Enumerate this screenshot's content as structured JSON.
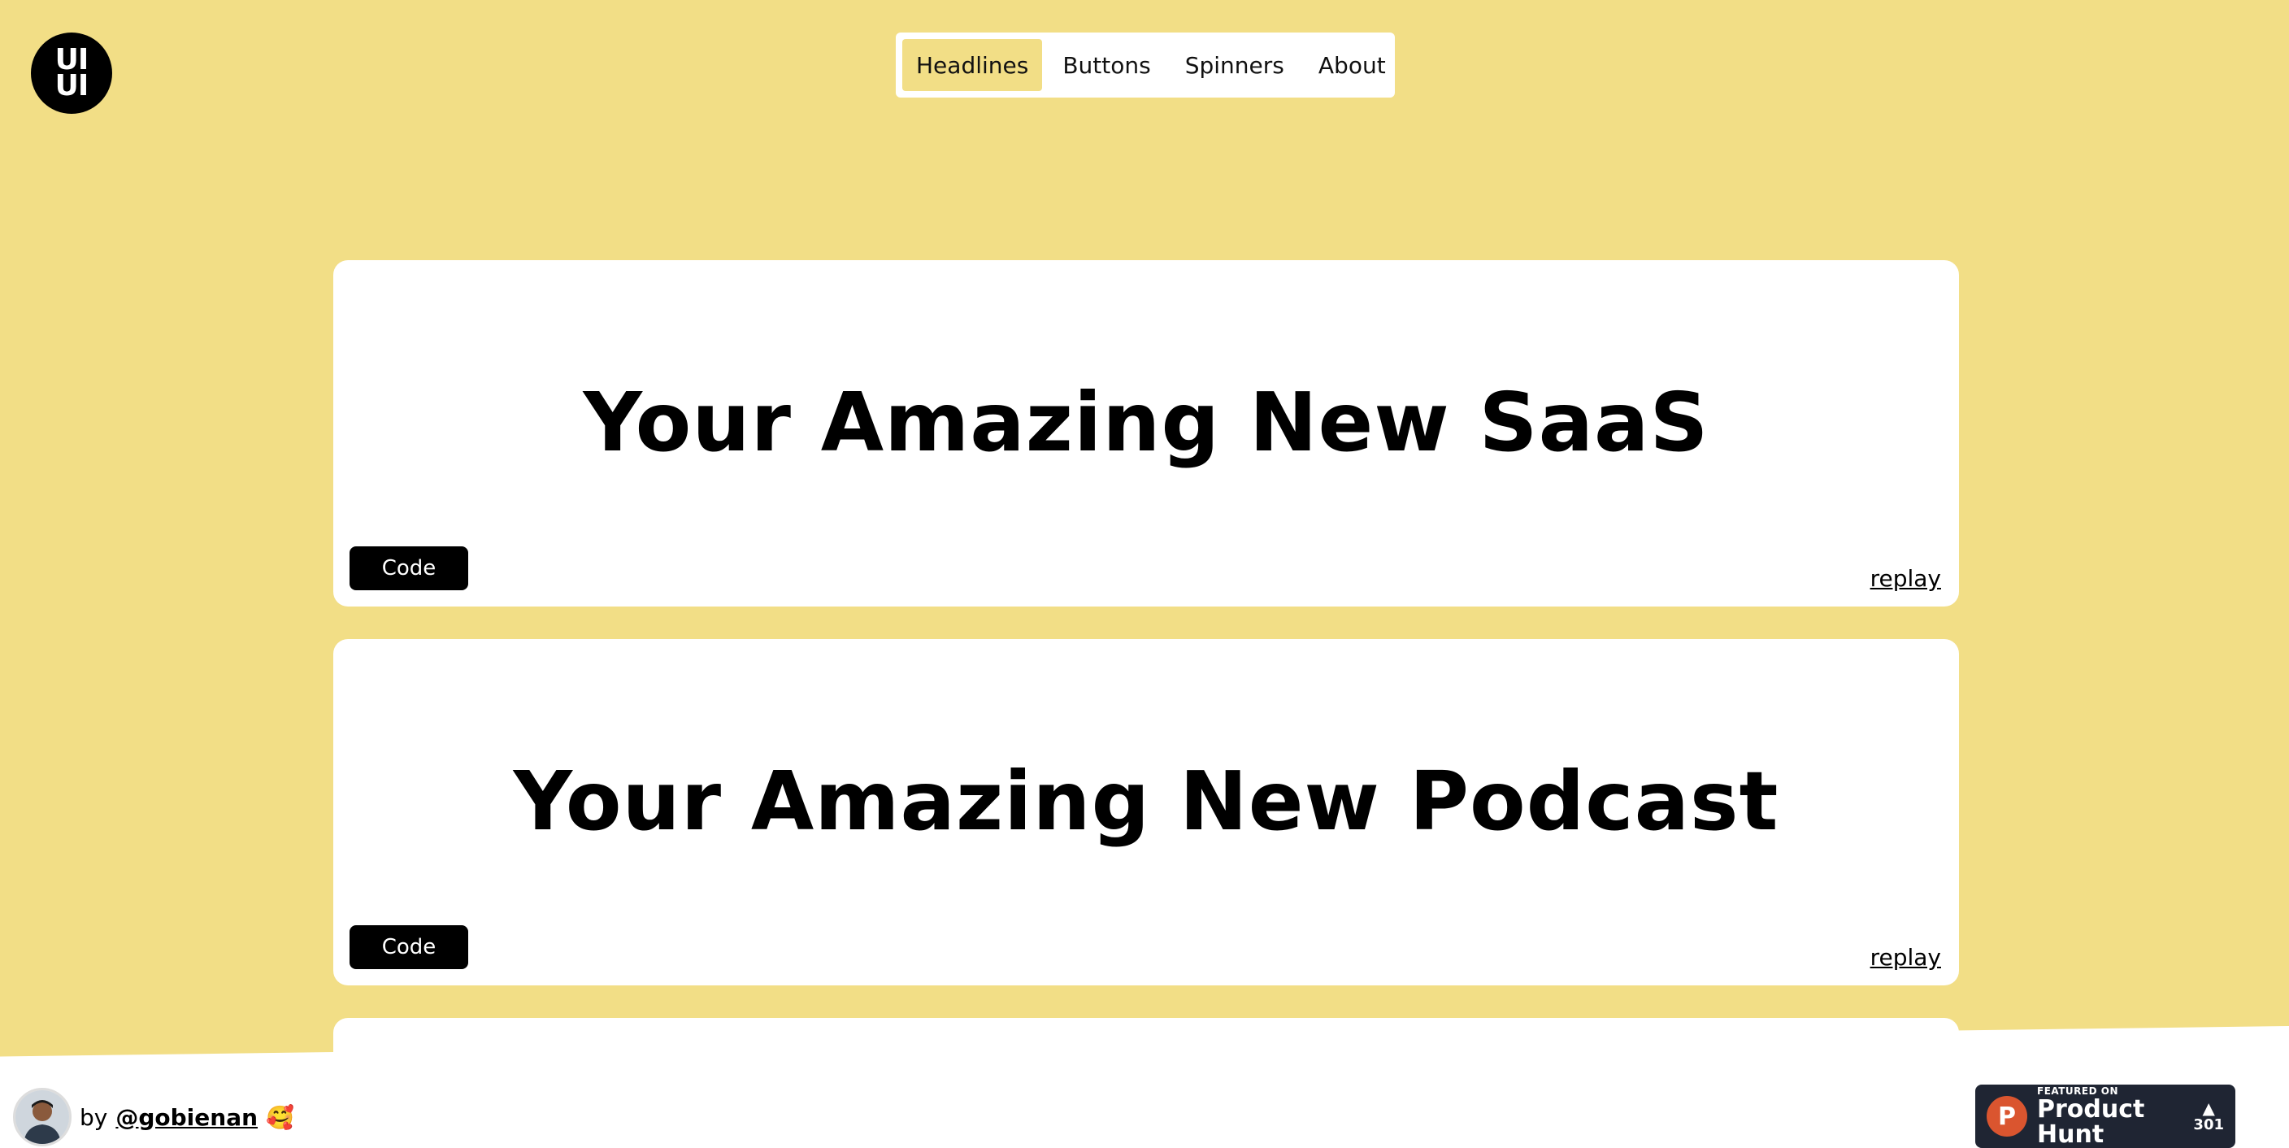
{
  "logo": {
    "line1": "UI",
    "line2": "UI"
  },
  "nav": {
    "items": [
      {
        "label": "Headlines",
        "active": true
      },
      {
        "label": "Buttons",
        "active": false
      },
      {
        "label": "Spinners",
        "active": false
      },
      {
        "label": "About",
        "active": false
      }
    ]
  },
  "cards": [
    {
      "headline": "Your Amazing New SaaS",
      "code_label": "Code",
      "replay_label": "replay"
    },
    {
      "headline": "Your Amazing New Podcast",
      "code_label": "Code",
      "replay_label": "replay"
    }
  ],
  "footer": {
    "by_text": "by",
    "handle": "@gobienan",
    "emoji": "🥰"
  },
  "product_hunt": {
    "featured_text": "FEATURED ON",
    "name": "Product Hunt",
    "count": "301"
  },
  "colors": {
    "background": "#f2de86",
    "card": "#ffffff",
    "button": "#000000",
    "ph_badge": "#1f2533",
    "ph_logo": "#da552f"
  }
}
